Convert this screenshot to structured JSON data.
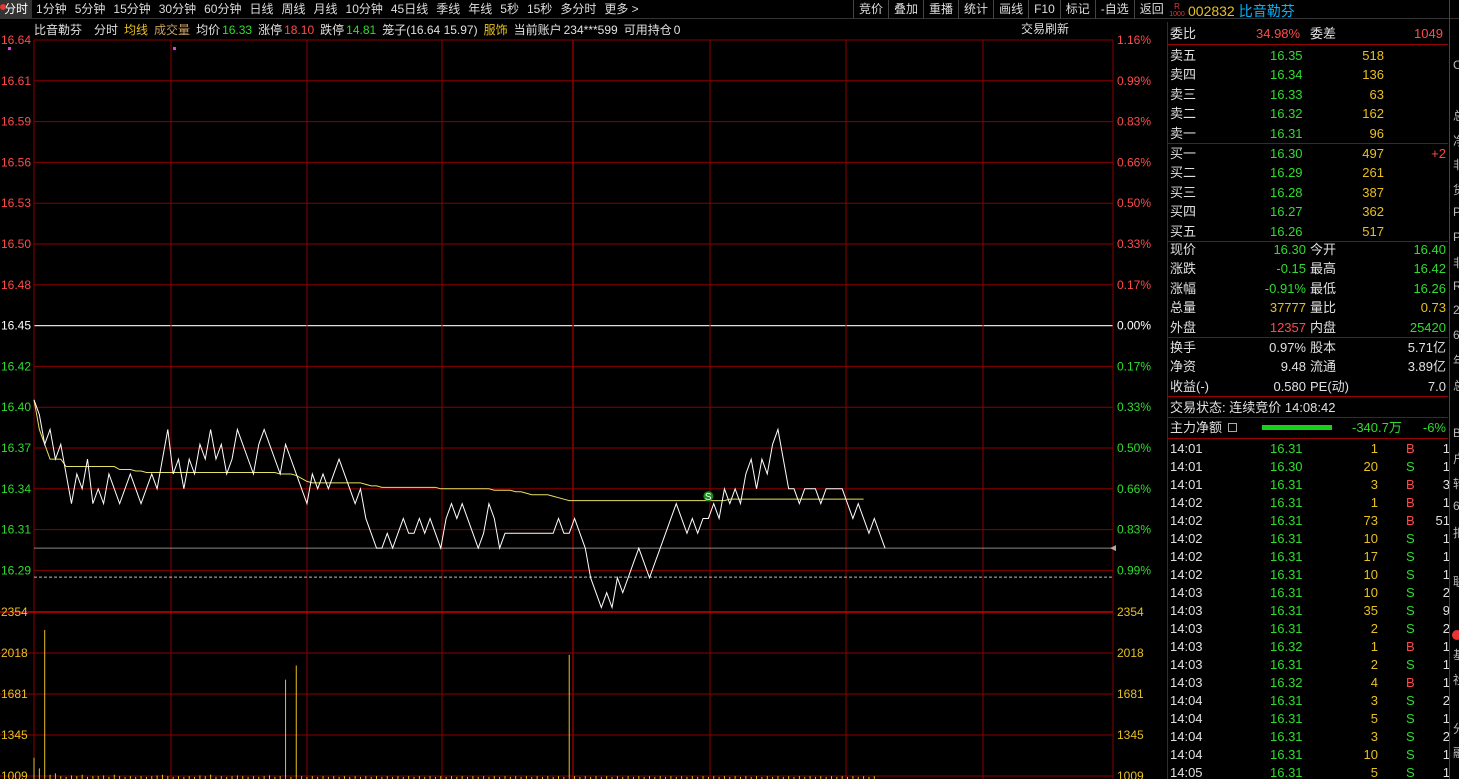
{
  "topbar": {
    "tabs": [
      "分时",
      "1分钟",
      "5分钟",
      "15分钟",
      "30分钟",
      "60分钟",
      "日线",
      "周线",
      "月线",
      "10分钟",
      "45日线",
      "季线",
      "年线",
      "5秒",
      "15秒",
      "多分时",
      "更多 >"
    ],
    "right_buttons": [
      "竞价",
      "叠加",
      "重播",
      "统计",
      "画线",
      "F10",
      "标记",
      "-自选",
      "返回"
    ]
  },
  "stock": {
    "logo_top": "R",
    "logo_bottom": "1000",
    "code": "002832",
    "name": "比音勒芬"
  },
  "info": {
    "name": "比音勒芬",
    "mode": "分时",
    "avg_line": "均线",
    "volume": "成交量",
    "avg_label": "均价",
    "avg_value": "16.33",
    "limit_up_label": "涨停",
    "limit_up": "18.10",
    "limit_down_label": "跌停",
    "limit_down": "14.81",
    "cage": "笼子(16.64 15.97)",
    "fashion": "服饰",
    "account_label": "当前账户",
    "account": "234***599",
    "holding_label": "可用持仓",
    "holding": "0",
    "refresh": "交易刷新"
  },
  "chart_data": {
    "type": "line",
    "y_left_labels": [
      "16.64",
      "16.61",
      "16.59",
      "16.56",
      "16.53",
      "16.50",
      "16.48",
      "16.45",
      "16.42",
      "16.40",
      "16.37",
      "16.34",
      "16.31",
      "16.29"
    ],
    "y_right_labels": [
      "1.16%",
      "0.99%",
      "0.83%",
      "0.66%",
      "0.50%",
      "0.33%",
      "0.17%",
      "0.00%",
      "0.17%",
      "0.33%",
      "0.50%",
      "0.66%",
      "0.83%",
      "0.99%"
    ],
    "vol_labels": [
      "2354",
      "2018",
      "1681",
      "1345",
      "1009"
    ],
    "ylim": [
      16.26,
      16.64
    ],
    "prev_close": 16.45,
    "current": 16.3,
    "price": [
      16.4,
      16.39,
      16.37,
      16.38,
      16.36,
      16.37,
      16.35,
      16.33,
      16.35,
      16.34,
      16.36,
      16.33,
      16.34,
      16.33,
      16.35,
      16.34,
      16.33,
      16.34,
      16.35,
      16.34,
      16.33,
      16.34,
      16.35,
      16.34,
      16.36,
      16.38,
      16.35,
      16.36,
      16.34,
      16.36,
      16.35,
      16.37,
      16.36,
      16.38,
      16.36,
      16.37,
      16.35,
      16.36,
      16.38,
      16.37,
      16.36,
      16.35,
      16.37,
      16.38,
      16.37,
      16.36,
      16.35,
      16.37,
      16.36,
      16.35,
      16.34,
      16.33,
      16.35,
      16.34,
      16.35,
      16.34,
      16.35,
      16.36,
      16.35,
      16.34,
      16.33,
      16.34,
      16.32,
      16.31,
      16.3,
      16.3,
      16.31,
      16.3,
      16.31,
      16.32,
      16.31,
      16.31,
      16.32,
      16.31,
      16.32,
      16.31,
      16.3,
      16.32,
      16.33,
      16.32,
      16.33,
      16.32,
      16.31,
      16.3,
      16.31,
      16.33,
      16.32,
      16.3,
      16.31,
      16.31,
      16.31,
      16.31,
      16.31,
      16.31,
      16.31,
      16.31,
      16.31,
      16.31,
      16.32,
      16.31,
      16.31,
      16.32,
      16.31,
      16.3,
      16.28,
      16.27,
      16.26,
      16.27,
      16.26,
      16.28,
      16.27,
      16.28,
      16.29,
      16.3,
      16.29,
      16.28,
      16.29,
      16.3,
      16.31,
      16.32,
      16.33,
      16.32,
      16.31,
      16.32,
      16.31,
      16.32,
      16.32,
      16.33,
      16.32,
      16.34,
      16.33,
      16.34,
      16.33,
      16.35,
      16.36,
      16.34,
      16.36,
      16.35,
      16.37,
      16.38,
      16.36,
      16.34,
      16.34,
      16.33,
      16.34,
      16.34,
      16.34,
      16.33,
      16.34,
      16.34,
      16.34,
      16.34,
      16.33,
      16.32,
      16.33,
      16.32,
      16.31,
      16.32,
      16.31,
      16.3
    ],
    "avg": [
      16.4,
      16.38,
      16.37,
      16.36,
      16.36,
      16.36,
      16.355,
      16.355,
      16.355,
      16.355,
      16.355,
      16.355,
      16.355,
      16.355,
      16.355,
      16.355,
      16.353,
      16.353,
      16.353,
      16.352,
      16.352,
      16.351,
      16.351,
      16.351,
      16.351,
      16.351,
      16.351,
      16.351,
      16.351,
      16.351,
      16.351,
      16.351,
      16.351,
      16.351,
      16.351,
      16.351,
      16.351,
      16.351,
      16.351,
      16.351,
      16.351,
      16.351,
      16.351,
      16.351,
      16.351,
      16.351,
      16.35,
      16.35,
      16.35,
      16.349,
      16.347,
      16.345,
      16.344,
      16.344,
      16.344,
      16.344,
      16.344,
      16.344,
      16.344,
      16.344,
      16.344,
      16.344,
      16.343,
      16.342,
      16.342,
      16.341,
      16.341,
      16.341,
      16.341,
      16.341,
      16.341,
      16.341,
      16.341,
      16.341,
      16.341,
      16.341,
      16.34,
      16.34,
      16.34,
      16.34,
      16.34,
      16.34,
      16.34,
      16.34,
      16.34,
      16.34,
      16.339,
      16.339,
      16.339,
      16.339,
      16.338,
      16.338,
      16.337,
      16.336,
      16.336,
      16.336,
      16.336,
      16.335,
      16.334,
      16.333,
      16.332,
      16.332,
      16.332,
      16.332,
      16.332,
      16.332,
      16.332,
      16.332,
      16.332,
      16.332,
      16.332,
      16.332,
      16.332,
      16.332,
      16.332,
      16.332,
      16.332,
      16.332,
      16.332,
      16.332,
      16.332,
      16.332,
      16.332,
      16.332,
      16.332,
      16.332,
      16.332,
      16.332,
      16.332,
      16.332,
      16.333,
      16.333,
      16.333,
      16.333,
      16.333,
      16.333,
      16.333,
      16.333,
      16.333,
      16.333,
      16.333,
      16.333,
      16.333,
      16.333,
      16.333,
      16.333,
      16.333,
      16.333,
      16.333,
      16.333,
      16.333,
      16.333,
      16.333,
      16.333,
      16.333,
      16.333
    ],
    "volume": [
      300,
      150,
      2100,
      60,
      80,
      40,
      30,
      50,
      40,
      60,
      30,
      40,
      40,
      50,
      30,
      60,
      40,
      30,
      40,
      30,
      40,
      30,
      40,
      50,
      60,
      40,
      30,
      40,
      30,
      40,
      30,
      50,
      40,
      60,
      30,
      40,
      30,
      40,
      50,
      40,
      30,
      40,
      30,
      40,
      50,
      30,
      40,
      1400,
      30,
      1600,
      40,
      30,
      40,
      30,
      40,
      30,
      40,
      30,
      40,
      30,
      40,
      30,
      40,
      30,
      40,
      30,
      40,
      30,
      40,
      30,
      40,
      30,
      40,
      30,
      40,
      30,
      40,
      30,
      40,
      30,
      40,
      30,
      40,
      30,
      40,
      30,
      40,
      30,
      40,
      30,
      40,
      30,
      40,
      30,
      40,
      30,
      40,
      30,
      40,
      30,
      1750,
      40,
      30,
      40,
      30,
      40,
      30,
      40,
      30,
      40,
      30,
      40,
      30,
      40,
      30,
      40,
      30,
      40,
      30,
      40,
      30,
      40,
      30,
      40,
      30,
      40,
      30,
      40,
      30,
      40,
      30,
      40,
      30,
      40,
      30,
      40,
      30,
      40,
      30,
      40,
      30,
      40,
      30,
      40,
      30,
      40,
      30,
      40,
      30,
      40,
      30,
      40,
      30,
      40,
      30,
      40,
      30,
      40
    ],
    "vol_max": 2354,
    "signal": "S"
  },
  "panel": {
    "ratio_label": "委比",
    "ratio": "34.98%",
    "diff_label": "委差",
    "diff": "1049",
    "asks": [
      {
        "label": "卖五",
        "price": "16.35",
        "vol": "518"
      },
      {
        "label": "卖四",
        "price": "16.34",
        "vol": "136"
      },
      {
        "label": "卖三",
        "price": "16.33",
        "vol": "63"
      },
      {
        "label": "卖二",
        "price": "16.32",
        "vol": "162"
      },
      {
        "label": "卖一",
        "price": "16.31",
        "vol": "96"
      }
    ],
    "bids": [
      {
        "label": "买一",
        "price": "16.30",
        "vol": "497",
        "chg": "+2"
      },
      {
        "label": "买二",
        "price": "16.29",
        "vol": "261",
        "chg": ""
      },
      {
        "label": "买三",
        "price": "16.28",
        "vol": "387",
        "chg": ""
      },
      {
        "label": "买四",
        "price": "16.27",
        "vol": "362",
        "chg": ""
      },
      {
        "label": "买五",
        "price": "16.26",
        "vol": "517",
        "chg": ""
      }
    ],
    "stats": [
      {
        "l1": "现价",
        "v1": "16.30",
        "c1": "green",
        "l2": "今开",
        "v2": "16.40",
        "c2": "green"
      },
      {
        "l1": "涨跌",
        "v1": "-0.15",
        "c1": "green",
        "l2": "最高",
        "v2": "16.42",
        "c2": "green"
      },
      {
        "l1": "涨幅",
        "v1": "-0.91%",
        "c1": "green",
        "l2": "最低",
        "v2": "16.26",
        "c2": "green"
      },
      {
        "l1": "总量",
        "v1": "37777",
        "c1": "yellow",
        "l2": "量比",
        "v2": "0.73",
        "c2": "yellow"
      },
      {
        "l1": "外盘",
        "v1": "12357",
        "c1": "red",
        "l2": "内盘",
        "v2": "25420",
        "c2": "green"
      }
    ],
    "stats2": [
      {
        "l1": "换手",
        "v1": "0.97%",
        "l2": "股本",
        "v2": "5.71亿"
      },
      {
        "l1": "净资",
        "v1": "9.48",
        "l2": "流通",
        "v2": "3.89亿"
      },
      {
        "l1": "收益(-)",
        "v1": "0.580",
        "l2": "PE(动)",
        "v2": "7.0"
      }
    ],
    "trade_status": "交易状态: 连续竞价 14:08:42",
    "main_flow_label": "主力净额",
    "main_flow": "-340.7万",
    "main_flow_pct": "-6%",
    "ticks": [
      {
        "t": "14:01",
        "p": "16.31",
        "v": "1",
        "s": "B",
        "n": "1"
      },
      {
        "t": "14:01",
        "p": "16.30",
        "v": "20",
        "s": "S",
        "n": "1"
      },
      {
        "t": "14:01",
        "p": "16.31",
        "v": "3",
        "s": "B",
        "n": "3"
      },
      {
        "t": "14:02",
        "p": "16.31",
        "v": "1",
        "s": "B",
        "n": "1"
      },
      {
        "t": "14:02",
        "p": "16.31",
        "v": "73",
        "s": "B",
        "n": "51"
      },
      {
        "t": "14:02",
        "p": "16.31",
        "v": "10",
        "s": "S",
        "n": "1"
      },
      {
        "t": "14:02",
        "p": "16.31",
        "v": "17",
        "s": "S",
        "n": "1"
      },
      {
        "t": "14:02",
        "p": "16.31",
        "v": "10",
        "s": "S",
        "n": "1"
      },
      {
        "t": "14:03",
        "p": "16.31",
        "v": "10",
        "s": "S",
        "n": "2"
      },
      {
        "t": "14:03",
        "p": "16.31",
        "v": "35",
        "s": "S",
        "n": "9"
      },
      {
        "t": "14:03",
        "p": "16.31",
        "v": "2",
        "s": "S",
        "n": "2"
      },
      {
        "t": "14:03",
        "p": "16.32",
        "v": "1",
        "s": "B",
        "n": "1"
      },
      {
        "t": "14:03",
        "p": "16.31",
        "v": "2",
        "s": "S",
        "n": "1"
      },
      {
        "t": "14:03",
        "p": "16.32",
        "v": "4",
        "s": "B",
        "n": "1"
      },
      {
        "t": "14:04",
        "p": "16.31",
        "v": "3",
        "s": "S",
        "n": "2"
      },
      {
        "t": "14:04",
        "p": "16.31",
        "v": "5",
        "s": "S",
        "n": "1"
      },
      {
        "t": "14:04",
        "p": "16.31",
        "v": "3",
        "s": "S",
        "n": "2"
      },
      {
        "t": "14:04",
        "p": "16.31",
        "v": "10",
        "s": "S",
        "n": "1"
      },
      {
        "t": "14:05",
        "p": "16.31",
        "v": "5",
        "s": "S",
        "n": "1"
      }
    ]
  },
  "edge_chars": [
    "C",
    "",
    "总",
    "净",
    "非",
    "货",
    "P",
    "P",
    "非",
    "R",
    "2",
    "6",
    "年",
    "总",
    "",
    "B",
    "户",
    "转",
    "6",
    "扣",
    "",
    "联",
    "",
    "",
    "基",
    "社",
    "",
    "分",
    "融"
  ]
}
